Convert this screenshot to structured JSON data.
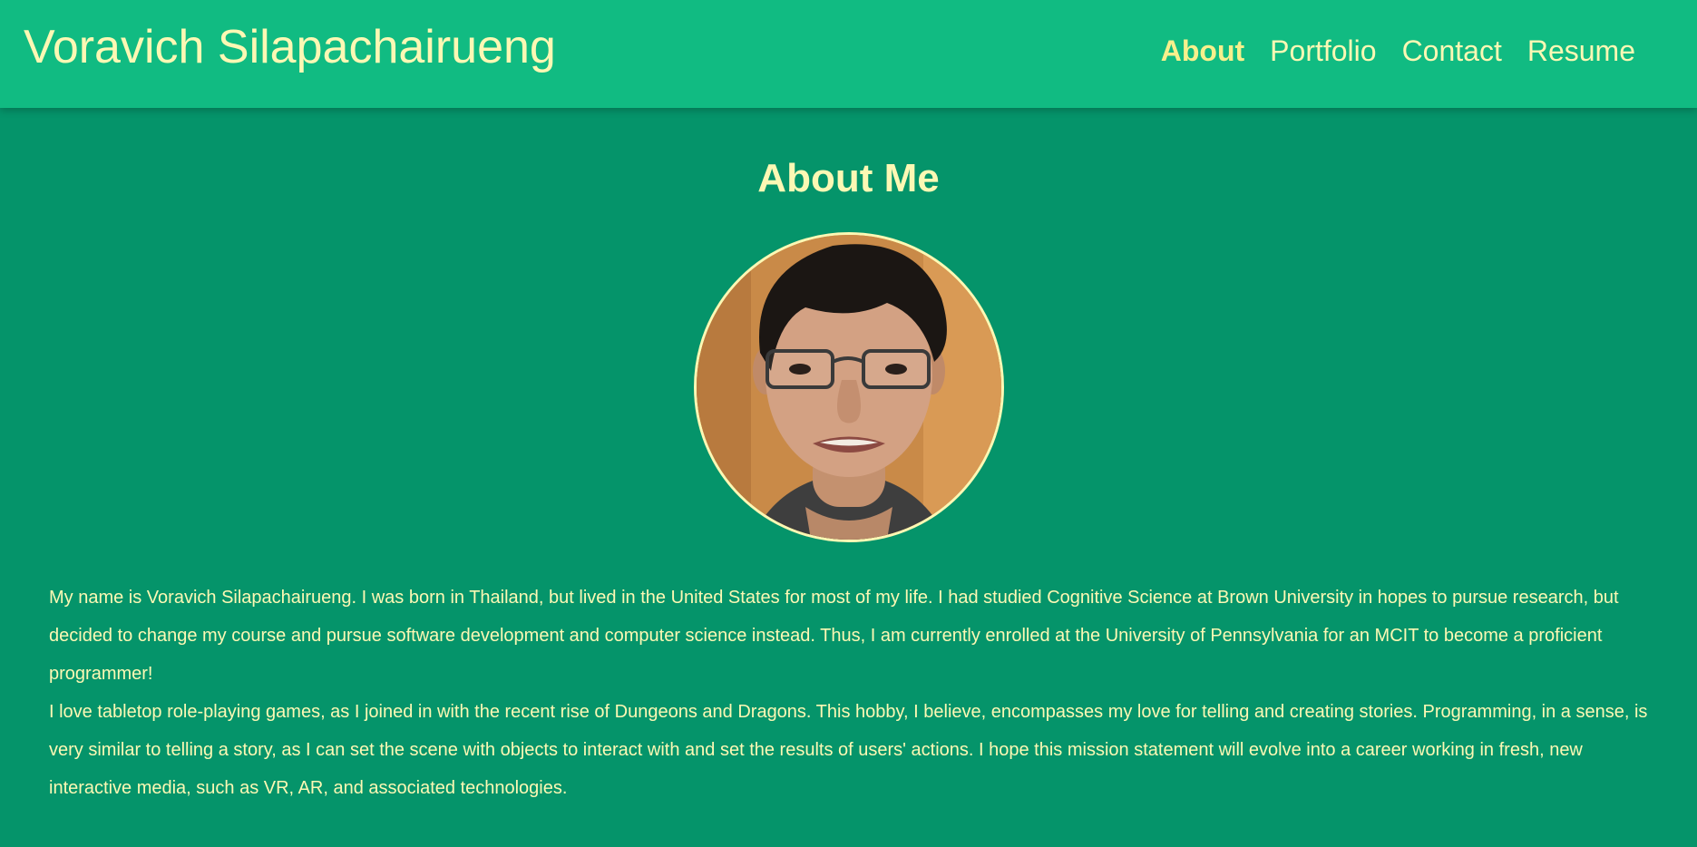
{
  "header": {
    "site_title": "Voravich Silapachairueng",
    "nav": [
      {
        "label": "About",
        "active": true
      },
      {
        "label": "Portfolio",
        "active": false
      },
      {
        "label": "Contact",
        "active": false
      },
      {
        "label": "Resume",
        "active": false
      }
    ]
  },
  "main": {
    "heading": "About Me",
    "paragraphs": [
      "My name is Voravich Silapachairueng. I was born in Thailand, but lived in the United States for most of my life. I had studied Cognitive Science at Brown University in hopes to pursue research, but decided to change my course and pursue software development and computer science instead. Thus, I am currently enrolled at the University of Pennsylvania for an MCIT to become a proficient programmer!",
      "I love tabletop role-playing games, as I joined in with the recent rise of Dungeons and Dragons. This hobby, I believe, encompasses my love for telling and creating stories. Programming, in a sense, is very similar to telling a story, as I can set the scene with objects to interact with and set the results of users' actions. I hope this mission statement will evolve into a career working in fresh, new interactive media, such as VR, AR, and associated technologies."
    ]
  },
  "colors": {
    "header_bg": "#11bb82",
    "page_bg": "#05946a",
    "text": "#fcf8b4",
    "active_nav": "#f7f08c"
  }
}
